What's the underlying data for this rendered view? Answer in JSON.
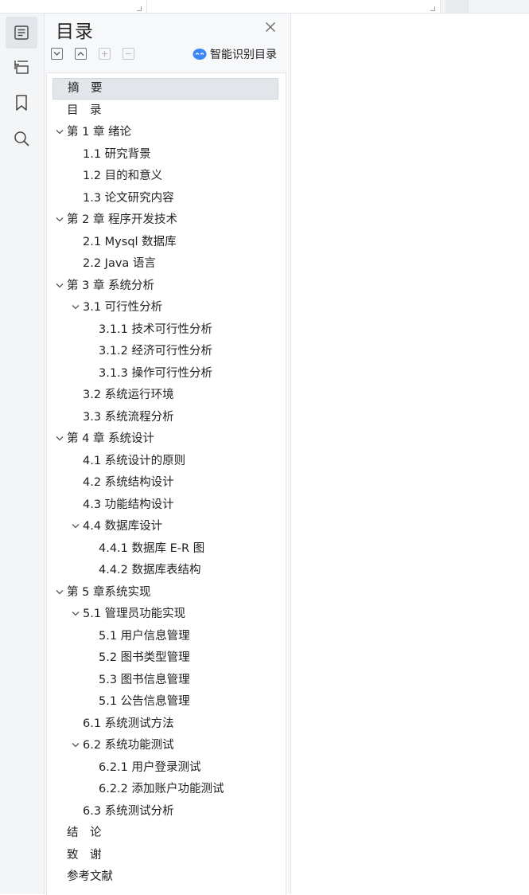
{
  "sidebar_rail": {
    "items": [
      {
        "icon": "toc-icon",
        "active": true
      },
      {
        "icon": "outline-icon",
        "active": false
      },
      {
        "icon": "bookmark-icon",
        "active": false
      },
      {
        "icon": "search-icon",
        "active": false
      }
    ]
  },
  "panel": {
    "title": "目录",
    "smart_toc_label": "智能识别目录",
    "accent": "#3d86f5"
  },
  "toc": [
    {
      "text": "摘　要",
      "level": 0,
      "expander": false,
      "selected": true
    },
    {
      "text": "目　录",
      "level": 0,
      "expander": false
    },
    {
      "text": "第 1 章  绪论",
      "level": 0,
      "expander": true
    },
    {
      "text": "1.1  研究背景",
      "level": 1,
      "expander": false
    },
    {
      "text": "1.2 目的和意义",
      "level": 1,
      "expander": false
    },
    {
      "text": "1.3  论文研究内容",
      "level": 1,
      "expander": false
    },
    {
      "text": "第 2 章  程序开发技术",
      "level": 0,
      "expander": true
    },
    {
      "text": "2.1 Mysql 数据库",
      "level": 1,
      "expander": false
    },
    {
      "text": "2.2 Java 语言",
      "level": 1,
      "expander": false
    },
    {
      "text": "第 3 章  系统分析",
      "level": 0,
      "expander": true
    },
    {
      "text": "3.1 可行性分析",
      "level": 1,
      "expander": true
    },
    {
      "text": "3.1.1 技术可行性分析",
      "level": 2,
      "expander": false
    },
    {
      "text": "3.1.2 经济可行性分析",
      "level": 2,
      "expander": false
    },
    {
      "text": "3.1.3 操作可行性分析",
      "level": 2,
      "expander": false
    },
    {
      "text": "3.2 系统运行环境",
      "level": 1,
      "expander": false
    },
    {
      "text": "3.3 系统流程分析",
      "level": 1,
      "expander": false
    },
    {
      "text": "第 4 章  系统设计",
      "level": 0,
      "expander": true
    },
    {
      "text": "4.1  系统设计的原则",
      "level": 1,
      "expander": false
    },
    {
      "text": "4.2  系统结构设计",
      "level": 1,
      "expander": false
    },
    {
      "text": "4.3 功能结构设计",
      "level": 1,
      "expander": false
    },
    {
      "text": "4.4 数据库设计",
      "level": 1,
      "expander": true
    },
    {
      "text": "4.4.1  数据库 E-R 图",
      "level": 2,
      "expander": false
    },
    {
      "text": "4.4.2  数据库表结构",
      "level": 2,
      "expander": false
    },
    {
      "text": "第 5 章系统实现",
      "level": 0,
      "expander": true
    },
    {
      "text": "5.1 管理员功能实现",
      "level": 1,
      "expander": true
    },
    {
      "text": "5.1 用户信息管理",
      "level": 2,
      "expander": false
    },
    {
      "text": "5.2  图书类型管理",
      "level": 2,
      "expander": false
    },
    {
      "text": "5.3 图书信息管理",
      "level": 2,
      "expander": false
    },
    {
      "text": "5.1 公告信息管理",
      "level": 2,
      "expander": false
    },
    {
      "text": "6.1 系统测试方法",
      "level": 1,
      "expander": false
    },
    {
      "text": "6.2  系统功能测试",
      "level": 1,
      "expander": true
    },
    {
      "text": "6.2.1  用户登录测试",
      "level": 2,
      "expander": false
    },
    {
      "text": "6.2.2  添加账户功能测试",
      "level": 2,
      "expander": false
    },
    {
      "text": "6.3  系统测试分析",
      "level": 1,
      "expander": false
    },
    {
      "text": "结　论",
      "level": 0,
      "expander": false
    },
    {
      "text": "致　谢",
      "level": 0,
      "expander": false
    },
    {
      "text": "参考文献",
      "level": 0,
      "expander": false
    }
  ]
}
